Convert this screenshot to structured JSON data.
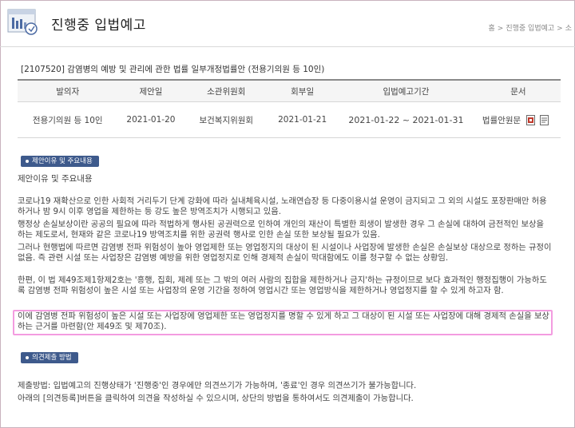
{
  "header": {
    "title": "진행중 입법예고",
    "breadcrumb": [
      "홈",
      "진행중 입법예고",
      "소"
    ]
  },
  "bill": {
    "title": "[2107520] 감염병의 예방 및 관리에 관한 법률 일부개정법률안 (전용기의원 등 10인)"
  },
  "table": {
    "headers": [
      "발의자",
      "제안일",
      "소관위원회",
      "회부일",
      "입법예고기간",
      "문서"
    ],
    "row": {
      "proposer": "전용기의원 등 10인",
      "proposed_date": "2021-01-20",
      "committee": "보건복지위원회",
      "referral_date": "2021-01-21",
      "period": "2021-01-22 ~ 2021-01-31",
      "document": "법률안원문"
    }
  },
  "section1": {
    "badge": "제안이유 및 주요내용",
    "subheading": "제안이유 및 주요내용",
    "paragraphs": [
      "코로나19 재확산으로 인한 사회적 거리두기 단계 강화에 따라 실내체육시설, 노래연습장 등 다중이용시설 운영이 금지되고 그 외의 시설도 포장판매만 허용하거나 밤 9시 이후 영업을 제한하는 등 강도 높은 방역조치가 시행되고 있음.",
      "행정상 손실보상이란 공공의 필요에 따라 적법하게 행사된 공권력으로 인하여 개인의 재산이 특별한 희생이 발생한 경우 그 손실에 대하여 금전적인 보상을 하는 제도로서, 현재와 같은 코로나19 방역조치를 위한 공권력 행사로 인한 손실 또한 보상될 필요가 있음.",
      "그러나 현행법에 따르면 감염병 전파 위험성이 높아 영업제한 또는 영업정지의 대상이 된 시설이나 사업장에 발생한 손실은 손실보상 대상으로 정하는 규정이 없음. 즉 관련 시설 또는 사업장은 감염병 예방을 위한 영업정지로 인해 경제적 손실이 막대함에도 이를 청구할 수 없는 상황임.",
      "한편, 이 법 제49조제1항제2호는 '흥행, 집회, 제례 또는 그 밖의 여러 사람의 집합을 제한하거나 금지'하는 규정이므로 보다 효과적인 행정집행이 가능하도록 감염병 전파 위험성이 높은 시설 또는 사업장의 운영 기간을 정하여 영업시간 또는 영업방식을 제한하거나 영업정지를 할 수 있게 하고자 함.",
      "이에 감염병 전파 위험성이 높은 시설 또는 사업장에 영업제한 또는 영업정지를 명할 수 있게 하고 그 대상이 된 시설 또는 사업장에 대해 경제적 손실을 보상하는 근거를 마련함(안 제49조 및 제70조)."
    ]
  },
  "section2": {
    "badge": "의견제출 방법",
    "lines": [
      "제출방법: 입법예고의 진행상태가 '진행중'인 경우에만 의견쓰기가 가능하며, '종료'인 경우 의견쓰기가 불가능합니다.",
      "아래의 [의견등록]버튼을 클릭하여 의견을 작성하실 수 있으시며, 상단의 방법을 통하여서도 의견제출이 가능합니다."
    ]
  },
  "colors": {
    "badge_bg": "#3e5a8c",
    "highlight_border": "#f39ce0",
    "table_header_bg": "#f5f5f5"
  },
  "icons": [
    "site-logo-icon",
    "hwp-document-icon",
    "pdf-document-icon"
  ]
}
